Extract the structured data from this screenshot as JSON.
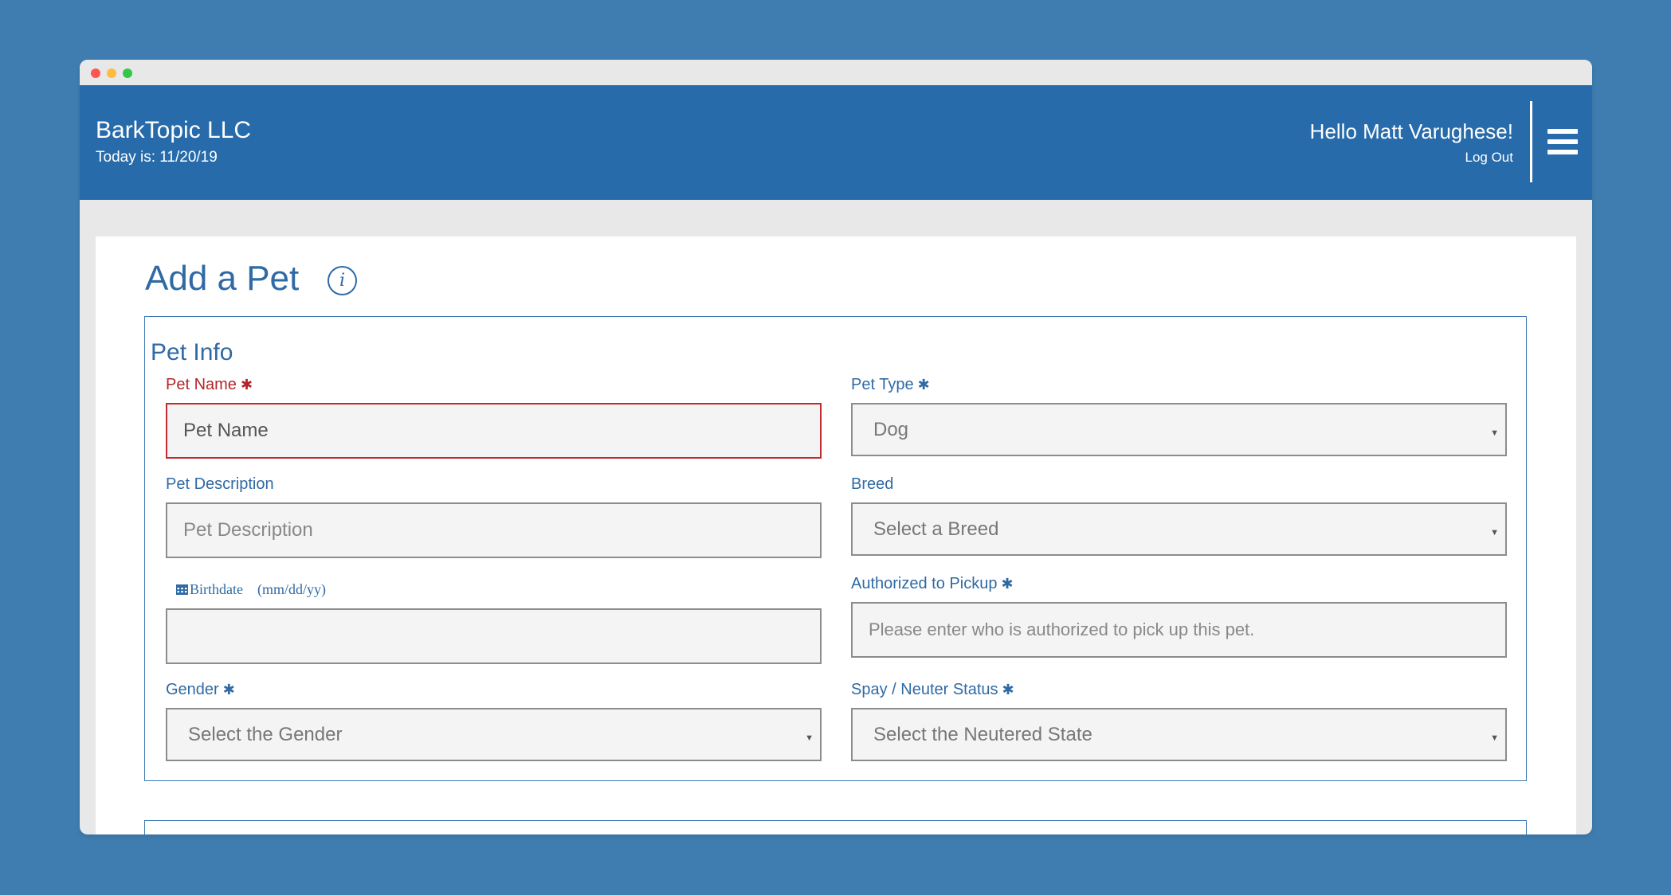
{
  "header": {
    "company": "BarkTopic LLC",
    "today": "Today is: 11/20/19",
    "greeting": "Hello Matt Varughese!",
    "logout": "Log Out",
    "menu_icon": "hamburger-menu-icon"
  },
  "page": {
    "title": "Add a Pet",
    "info_icon": "i"
  },
  "pet_info": {
    "section_title": "Pet Info",
    "required_marker": "✱",
    "pet_name": {
      "label": "Pet Name",
      "placeholder": "Pet Name",
      "value": ""
    },
    "pet_type": {
      "label": "Pet Type",
      "value": "Dog"
    },
    "pet_description": {
      "label": "Pet Description",
      "placeholder": "Pet Description",
      "value": ""
    },
    "breed": {
      "label": "Breed",
      "value": "Select a Breed"
    },
    "birthdate": {
      "label": "Birthdate",
      "hint": "(mm/dd/yy)",
      "value": ""
    },
    "authorized_pickup": {
      "label": "Authorized to Pickup",
      "placeholder": "Please enter who is authorized to pick up this pet.",
      "value": ""
    },
    "gender": {
      "label": "Gender",
      "value": "Select the Gender"
    },
    "neuter_status": {
      "label": "Spay / Neuter Status",
      "value": "Select the Neutered State"
    }
  },
  "colors": {
    "background": "#3f7db0",
    "header": "#276bab",
    "accent": "#2f6aa4",
    "error": "#c12a2e"
  }
}
